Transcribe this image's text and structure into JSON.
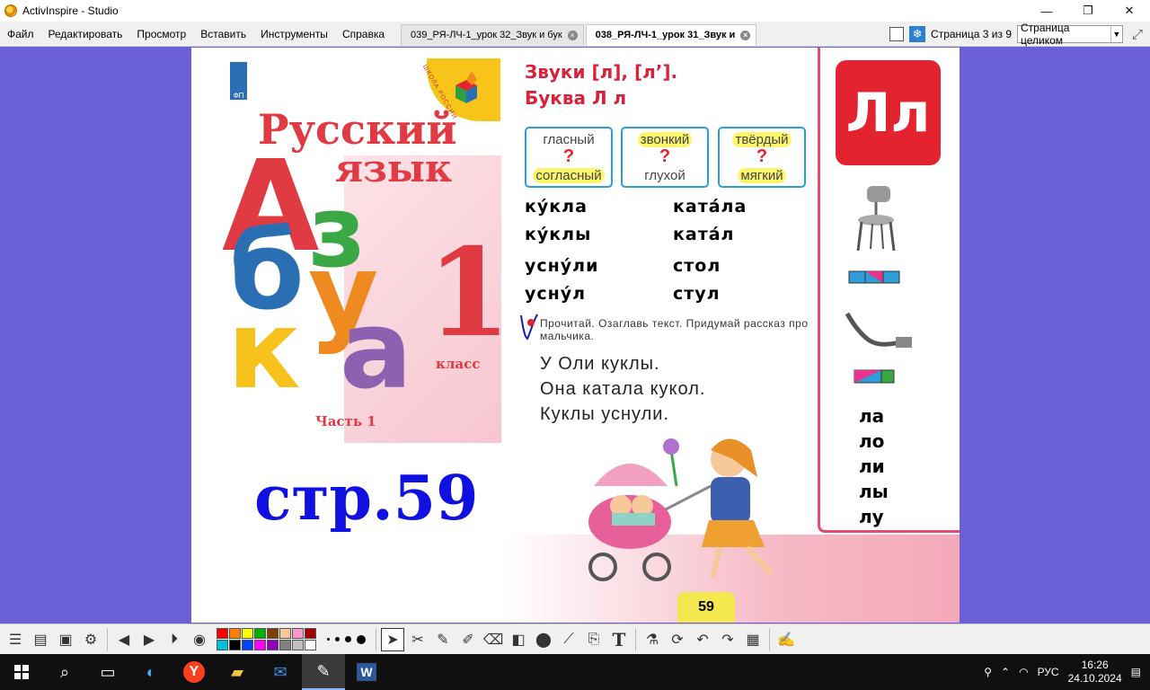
{
  "window": {
    "title": "ActivInspire - Studio"
  },
  "menu": [
    "Файл",
    "Редактировать",
    "Просмотр",
    "Вставить",
    "Инструменты",
    "Справка"
  ],
  "tabs": [
    {
      "label": "039_РЯ-ЛЧ-1_урок 32_Звук и бук",
      "active": false
    },
    {
      "label": "038_РЯ-ЛЧ-1_урок 31_Звук и",
      "active": true
    }
  ],
  "page_indicator": "Страница 3 из 9",
  "zoom_select": "Страница целиком",
  "cover": {
    "title_line1": "Русский",
    "title_line2": "язык",
    "letters": [
      "А",
      "з",
      "б",
      "у",
      "к",
      "а"
    ],
    "grade_number": "1",
    "grade_word": "класс",
    "part": "Часть 1",
    "publisher_logo": "ФП",
    "school_label": "ШКОЛА РОССИИ"
  },
  "page_reference": "стр.59",
  "textbook": {
    "title_line1": "Звуки  [л],  [л’].",
    "title_line2": "Буква  Л  л",
    "badge": "Лл",
    "boxes": [
      {
        "top": "гласный",
        "mark": "?",
        "bottom": "согласный"
      },
      {
        "top": "звонкий",
        "mark": "?",
        "bottom": "глухой"
      },
      {
        "top": "твёрдый",
        "mark": "?",
        "bottom": "мягкий"
      }
    ],
    "words_left": [
      "ку́кла",
      "ку́клы",
      "усну́ли",
      "усну́л"
    ],
    "words_right": [
      "ката́ла",
      "ката́л",
      "стол",
      "стул"
    ],
    "instruction": "Прочитай. Озаглавь текст. Придумай рассказ про мальчика.",
    "story": [
      "У  Оли  куклы.",
      "Она  катала  кукол.",
      "Куклы  уснули."
    ],
    "syllables": [
      "ла",
      "ло",
      "ли",
      "лы",
      "лу"
    ],
    "page_number": "59"
  },
  "palette": [
    "#ff0000",
    "#ff8000",
    "#ffff00",
    "#00b000",
    "#804000",
    "#f5c89a",
    "#ff99cc",
    "#a00000",
    "#00c0e0",
    "#000000",
    "#0040ff",
    "#ff00ff",
    "#9000c0",
    "#808080",
    "#c0c0c0",
    "#ffffff"
  ],
  "taskbar": {
    "lang": "РУС",
    "time": "16:26",
    "date": "24.10.2024"
  }
}
